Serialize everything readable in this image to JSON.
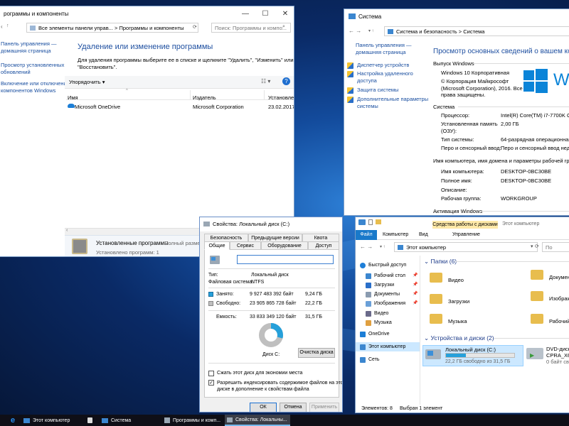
{
  "progs": {
    "title": "рограммы и компоненты",
    "address": "Все элементы панели управ...  >  Программы и компоненты",
    "search_placeholder": "Поиск: Программы и компо...",
    "sidebar": [
      "Панель управления —",
      "домашняя страница",
      "Просмотр установленных",
      "обновлений",
      "Включение или отключение",
      "компонентов Windows"
    ],
    "heading": "Удаление или изменение программы",
    "description1": "Для удаления программы выберите ее в списке и щелкните \"Удалить\", \"Изменить\" или",
    "description2": "\"Восстановить\".",
    "organize": "Упорядочить",
    "columns": [
      "Имя",
      "Издатель",
      "Установле"
    ],
    "row": {
      "name": "Microsoft OneDrive",
      "publisher": "Microsoft Corporation",
      "date": "23.02.2017"
    },
    "status_title": "Установленные программы",
    "status_size": "Полный размер",
    "status_count": "Установлено программ: 1"
  },
  "system": {
    "title": "Система",
    "address": "Система и безопасность  >  Система",
    "sidebar": [
      "Панель управления —",
      "домашняя страница",
      "Диспетчер устройств",
      "Настройка удаленного",
      "доступа",
      "Защита системы",
      "Дополнительные параметры",
      "системы"
    ],
    "heading": "Просмотр основных сведений о вашем компьютере",
    "sec_windows": "Выпуск Windows",
    "edition": "Windows 10 Корпоративная",
    "copy1": "© Корпорация Майкрософт",
    "copy2": "(Microsoft Corporation), 2016. Все",
    "copy3": "права защищены.",
    "logo_text": "W",
    "sec_system": "Система",
    "rows": [
      [
        "Процессор:",
        "Intel(R) Core(TM) i7-7700K CPU @"
      ],
      [
        "Установленная память",
        "2,00 ГБ"
      ],
      [
        "(ОЗУ):",
        ""
      ],
      [
        "Тип системы:",
        "64-разрядная операционная сис"
      ],
      [
        "Перо и сенсорный ввод:",
        "Перо и сенсорный ввод недосту"
      ]
    ],
    "sec_name": "Имя компьютера, имя домена и параметры рабочей группы",
    "rows2": [
      [
        "Имя компьютера:",
        "DESKTOP-0BC30BE"
      ],
      [
        "Полное имя:",
        "DESKTOP-0BC30BE"
      ],
      [
        "Описание:",
        ""
      ],
      [
        "Рабочая группа:",
        "WORKGROUP"
      ]
    ],
    "sec_activation": "Активация Windows"
  },
  "props": {
    "title": "Свойства: Локальный диск (C:)",
    "tabs_top": [
      "Безопасность",
      "Предыдущие версии",
      "Квота"
    ],
    "tabs_bottom": [
      "Общие",
      "Сервис",
      "Оборудование",
      "Доступ"
    ],
    "type_label": "Тип:",
    "type_value": "Локальный диск",
    "fs_label": "Файловая система:",
    "fs_value": "NTFS",
    "used_label": "Занято:",
    "used_bytes": "9 927 483 392 байт",
    "used_gb": "9,24 ГБ",
    "free_label": "Свободно:",
    "free_bytes": "23 905 865 728 байт",
    "free_gb": "22,2 ГБ",
    "cap_label": "Емкость:",
    "cap_bytes": "33 833 349 120 байт",
    "cap_gb": "31,5 ГБ",
    "used_fraction": 0.293,
    "disk_label": "Диск C:",
    "cleanup": "Очистка диска",
    "compress": "Сжать этот диск для экономии места",
    "index1": "Разрешить индексировать содержимое файлов на этом",
    "index2": "диске в дополнение к свойствам файла",
    "ok": "ОК",
    "cancel": "Отмена",
    "apply": "Применить",
    "used_color": "#26a0da",
    "free_color": "#bfbfbf"
  },
  "explorer": {
    "ribbon_tabs": [
      "Файл",
      "Компьютер",
      "Вид"
    ],
    "ribbon_context": "Средства работы с дисками",
    "ribbon_context2": "Управление",
    "ribbon_this": "Этот компьютер",
    "address": "Этот компьютер",
    "search_placeholder": "По",
    "nav": [
      "Быстрый доступ",
      "Рабочий стол",
      "Загрузки",
      "Документы",
      "Изображения",
      "Видео",
      "Музыка",
      "OneDrive",
      "Этот компьютер",
      "Сеть"
    ],
    "folders_header": "Папки (6)",
    "folders": [
      "Видео",
      "Загрузки",
      "Музыка",
      "Документ",
      "Изображе",
      "Рабочий ст"
    ],
    "drives_header": "Устройства и диски (2)",
    "drive_c": "Локальный диск (C:)",
    "drive_c_free": "22,2 ГБ свободно из 31,5 ГБ",
    "drive_dvd": "DVD-диско",
    "drive_dvd2": "CPRA_X6",
    "drive_dvd3": "0 байт сво",
    "status_items": "Элементов: 8",
    "status_selected": "Выбран 1 элемент"
  },
  "taskbar": {
    "items": [
      "Этот компьютер",
      "Система",
      "Программы и комп...",
      "Свойства: Локальны..."
    ]
  }
}
